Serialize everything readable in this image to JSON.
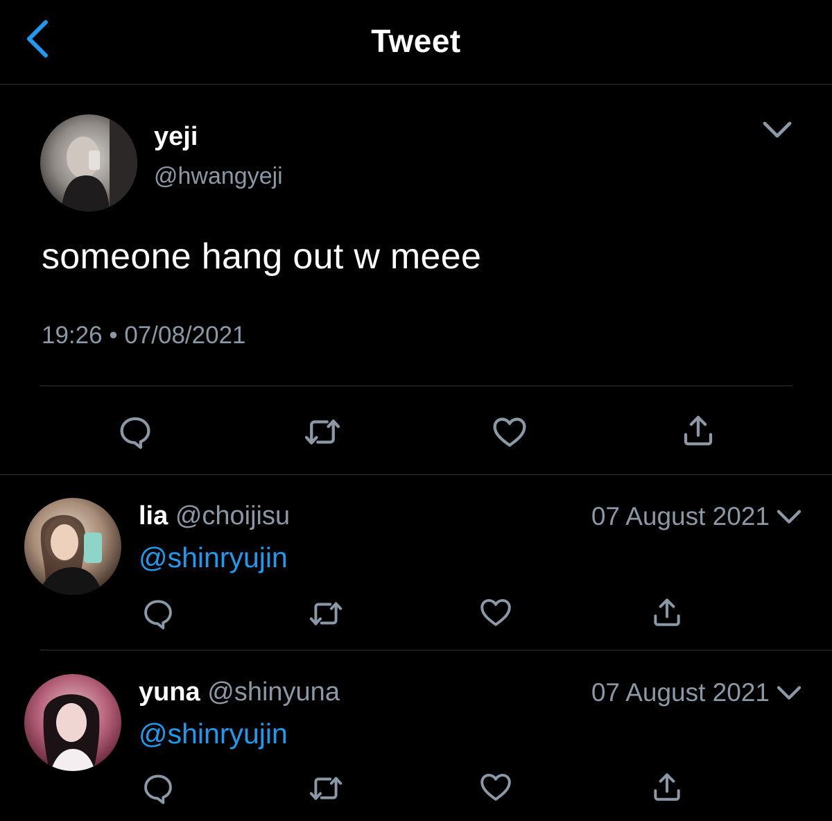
{
  "header": {
    "title": "Tweet",
    "back_icon": "chevron-left-icon"
  },
  "colors": {
    "background": "#000000",
    "accent": "#1d9bf0",
    "secondary_text": "#8b98a5",
    "divider": "#2f3336"
  },
  "main_tweet": {
    "display_name": "yeji",
    "handle": "@hwangyeji",
    "text": "someone hang out w meee",
    "time": "19:26",
    "separator": "•",
    "date": "07/08/2021",
    "actions": [
      "reply-icon",
      "retweet-icon",
      "like-icon",
      "share-icon"
    ]
  },
  "replies": [
    {
      "display_name": "lia",
      "handle": "@choijisu",
      "date": "07 August 2021",
      "text": "@shinryujin"
    },
    {
      "display_name": "yuna",
      "handle": "@shinyuna",
      "date": "07 August 2021",
      "text": "@shinryujin"
    }
  ]
}
